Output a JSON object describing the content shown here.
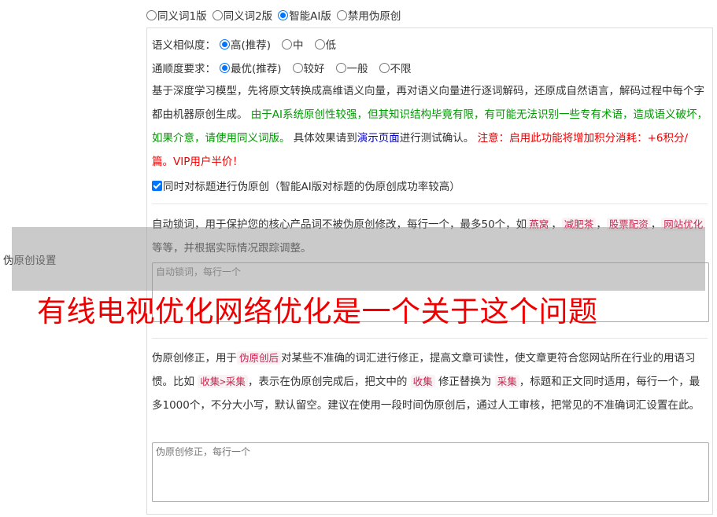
{
  "modes": [
    {
      "label": "同义词1版",
      "checked": false
    },
    {
      "label": "同义词2版",
      "checked": false
    },
    {
      "label": "智能AI版",
      "checked": true
    },
    {
      "label": "禁用伪原创",
      "checked": false
    }
  ],
  "similarity": {
    "label": "语义相似度：",
    "options": [
      {
        "label": "高(推荐)",
        "checked": true
      },
      {
        "label": "中",
        "checked": false
      },
      {
        "label": "低",
        "checked": false
      }
    ]
  },
  "fluency": {
    "label": "通顺度要求：",
    "options": [
      {
        "label": "最优(推荐)",
        "checked": true
      },
      {
        "label": "较好",
        "checked": false
      },
      {
        "label": "一般",
        "checked": false
      },
      {
        "label": "不限",
        "checked": false
      }
    ]
  },
  "ai_desc": {
    "part1": "基于深度学习模型，先将原文转换成高维语义向量，再对语义向量进行逐词解码，还原成自然语言，解码过程中每个字都由机器原创生成。",
    "warning": "由于AI系统原创性较强，但其知识结构毕竟有限，有可能无法识别一些专有术语，造成语义破坏，如果介意，请使用同义词版。",
    "part2": "具体效果请到",
    "demo_link": "演示页面",
    "part3": "进行测试确认。",
    "notice": "注意：启用此功能将增加积分消耗：+6积分/篇。VIP用户半价！"
  },
  "title_option": {
    "label": "同时对标题进行伪原创（智能AI版对标题的伪原创成功率较高）",
    "checked": true
  },
  "lock_desc": {
    "intro": "自动锁词，用于保护您的核心产品词不被伪原创修改，每行一个，最多50个，如",
    "examples": [
      "燕窝",
      "减肥茶",
      "股票配资",
      "网站优化"
    ],
    "sep": "，",
    "outro": "等等，并根据实际情况跟踪调整。"
  },
  "lock_input": {
    "placeholder": "自动锁词，每行一个",
    "value": ""
  },
  "section_label": "伪原创设置",
  "banner": "有线电视优化网络优化是一个关于这个问题",
  "fix_desc": {
    "p1": "伪原创修正，用于",
    "code1": "伪原创后",
    "p2": "对某些不准确的词汇进行修正，提高文章可读性，使文章更符合您网站所在行业的用语习惯。比如",
    "code2": "收集>采集",
    "p3": "，表示在伪原创完成后，把文中的",
    "code3": "收集",
    "p4": "修正替换为",
    "code4": "采集",
    "p5": "，标题和正文同时适用，每行一个，最多1000个，不分大小写，默认留空。建议在使用一段时间伪原创后，通过人工审核，把常见的不准确词汇设置在此。"
  },
  "fix_input": {
    "placeholder": "伪原创修正，每行一个",
    "value": ""
  }
}
